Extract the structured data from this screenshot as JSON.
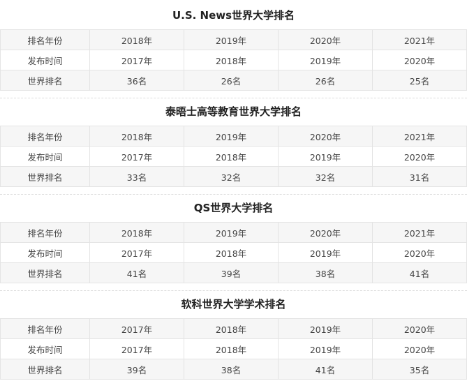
{
  "sections": [
    {
      "title": "U.S. News世界大学排名",
      "rows": [
        {
          "label": "排名年份",
          "cells": [
            "2018年",
            "2019年",
            "2020年",
            "2021年"
          ]
        },
        {
          "label": "发布时间",
          "cells": [
            "2017年",
            "2018年",
            "2019年",
            "2020年"
          ]
        },
        {
          "label": "世界排名",
          "cells": [
            "36名",
            "26名",
            "26名",
            "25名"
          ]
        }
      ]
    },
    {
      "title": "泰晤士高等教育世界大学排名",
      "rows": [
        {
          "label": "排名年份",
          "cells": [
            "2018年",
            "2019年",
            "2020年",
            "2021年"
          ]
        },
        {
          "label": "发布时间",
          "cells": [
            "2017年",
            "2018年",
            "2019年",
            "2020年"
          ]
        },
        {
          "label": "世界排名",
          "cells": [
            "33名",
            "32名",
            "32名",
            "31名"
          ]
        }
      ]
    },
    {
      "title": "QS世界大学排名",
      "rows": [
        {
          "label": "排名年份",
          "cells": [
            "2018年",
            "2019年",
            "2020年",
            "2021年"
          ]
        },
        {
          "label": "发布时间",
          "cells": [
            "2017年",
            "2018年",
            "2019年",
            "2020年"
          ]
        },
        {
          "label": "世界排名",
          "cells": [
            "41名",
            "39名",
            "38名",
            "41名"
          ]
        }
      ]
    },
    {
      "title": "软科世界大学学术排名",
      "rows": [
        {
          "label": "排名年份",
          "cells": [
            "2017年",
            "2018年",
            "2019年",
            "2020年"
          ]
        },
        {
          "label": "发布时间",
          "cells": [
            "2017年",
            "2018年",
            "2019年",
            "2020年"
          ]
        },
        {
          "label": "世界排名",
          "cells": [
            "39名",
            "38名",
            "41名",
            "35名"
          ]
        }
      ]
    }
  ]
}
